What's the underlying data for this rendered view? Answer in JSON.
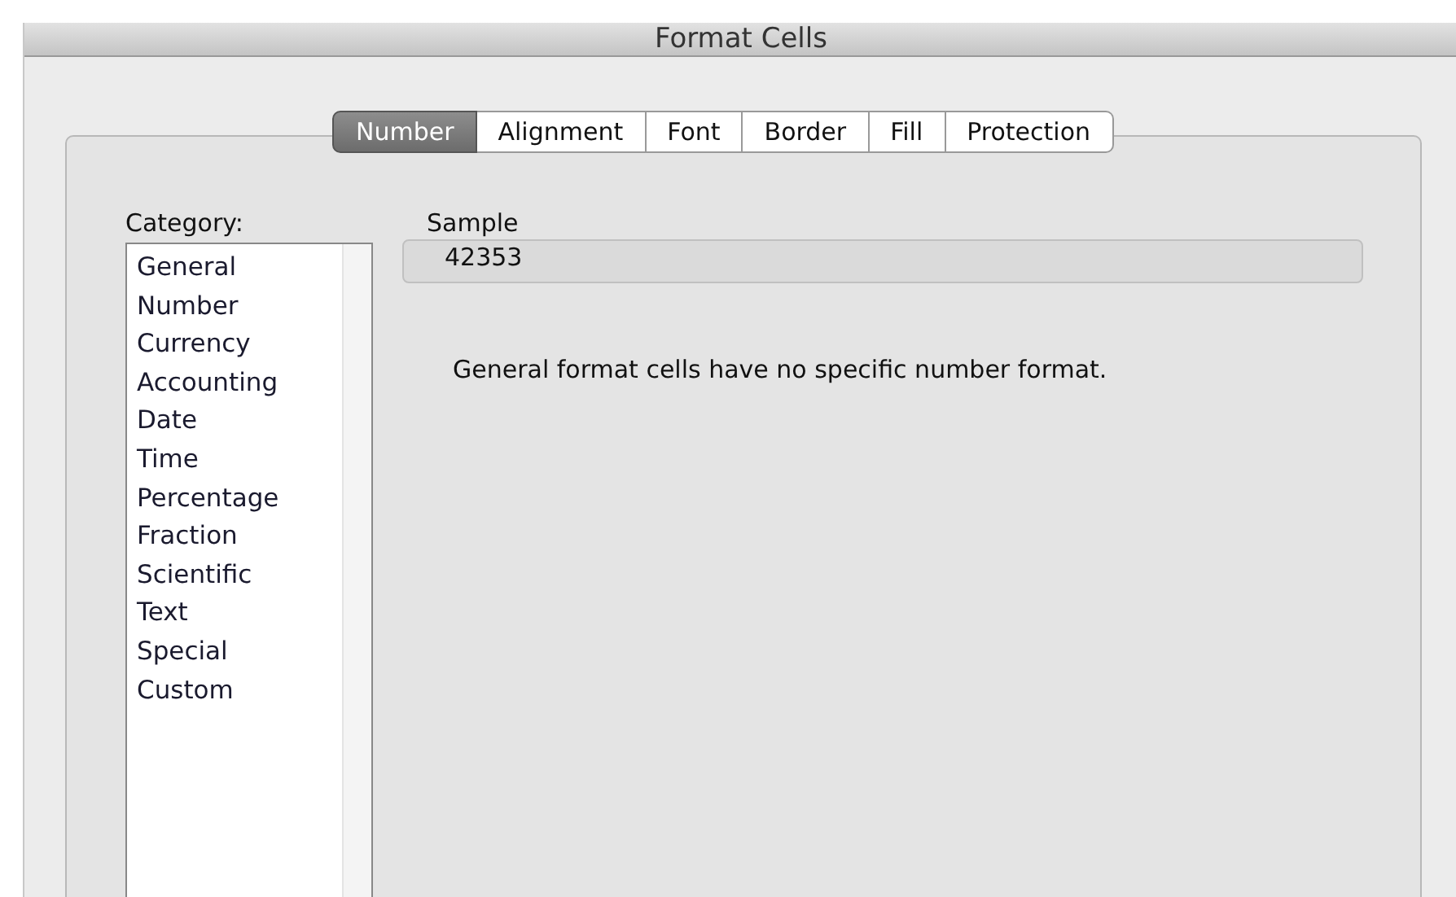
{
  "window": {
    "title": "Format Cells"
  },
  "tabs": [
    {
      "label": "Number",
      "selected": true
    },
    {
      "label": "Alignment",
      "selected": false
    },
    {
      "label": "Font",
      "selected": false
    },
    {
      "label": "Border",
      "selected": false
    },
    {
      "label": "Fill",
      "selected": false
    },
    {
      "label": "Protection",
      "selected": false
    }
  ],
  "category": {
    "label": "Category:",
    "items": [
      {
        "label": "General",
        "selected": false
      },
      {
        "label": "Number",
        "selected": false
      },
      {
        "label": "Currency",
        "selected": false
      },
      {
        "label": "Accounting",
        "selected": false
      },
      {
        "label": "Date",
        "selected": false
      },
      {
        "label": "Time",
        "selected": false
      },
      {
        "label": "Percentage",
        "selected": false
      },
      {
        "label": "Fraction",
        "selected": false
      },
      {
        "label": "Scientific",
        "selected": false
      },
      {
        "label": "Text",
        "selected": false
      },
      {
        "label": "Special",
        "selected": false
      },
      {
        "label": "Custom",
        "selected": false
      }
    ]
  },
  "sample": {
    "label": "Sample",
    "value": "42353"
  },
  "description": "General format cells have no specific number format."
}
